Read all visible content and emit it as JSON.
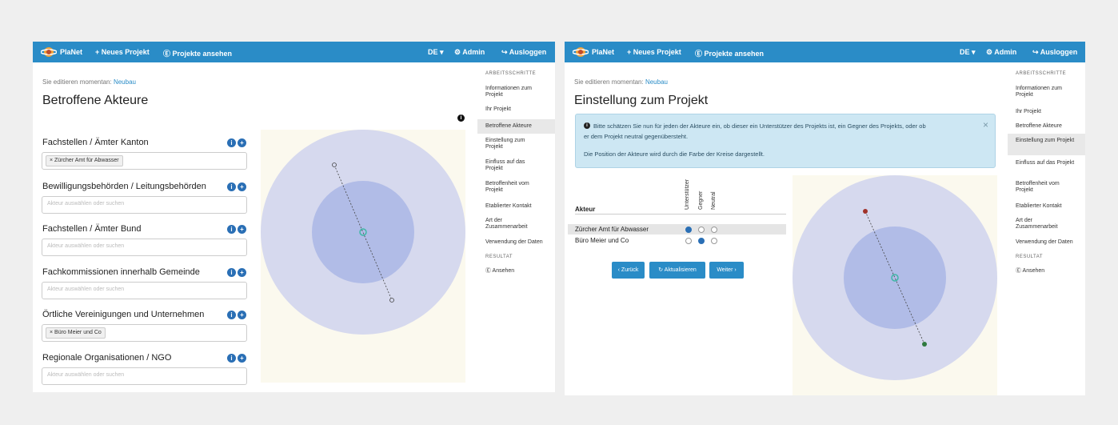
{
  "app": {
    "brand": "PlaNet",
    "nav_new": "+ Neues Projekt",
    "nav_view": "Ⓔ Projekte ansehen",
    "lang": "DE ▾",
    "admin": "⚙ Admin",
    "logout": "↪ Ausloggen"
  },
  "colors": {
    "primary": "#2a8cc7",
    "outer_circle": "#d6d9ee",
    "inner_circle": "#b1bce7",
    "chart_bg": "#fbf9ee",
    "marker_center": "#3fb7a7",
    "marker_red": "#a0322a",
    "marker_green": "#2f7a3e"
  },
  "sidebar": {
    "section_steps": "ARBEITSSCHRITTE",
    "items": [
      "Informationen zum Projekt",
      "Ihr Projekt",
      "Betroffene Akteure",
      "Einstellung zum Projekt",
      "Einfluss auf das Projekt",
      "Betroffenheit vom Projekt",
      "Etablierter Kontakt",
      "Art der Zusammenarbeit",
      "Verwendung der Daten"
    ],
    "section_result": "RESULTAT",
    "view": "Ⓔ Ansehen"
  },
  "left": {
    "editing_prefix": "Sie editieren momentan:",
    "project_name": "Neubau",
    "page_title": "Betroffene Akteure",
    "placeholder": "Akteur auswählen oder suchen",
    "groups": [
      {
        "label": "Fachstellen / Ämter Kanton",
        "tag": "× Zürcher Amt für Abwasser"
      },
      {
        "label": "Bewilligungsbehörden / Leitungsbehörden",
        "tag": ""
      },
      {
        "label": "Fachstellen / Ämter Bund",
        "tag": ""
      },
      {
        "label": "Fachkommissionen innerhalb Gemeinde",
        "tag": ""
      },
      {
        "label": "Örtliche Vereinigungen und Unternehmen",
        "tag": "× Büro Meier und Co"
      },
      {
        "label": "Regionale Organisationen / NGO",
        "tag": ""
      }
    ]
  },
  "right": {
    "editing_prefix": "Sie editieren momentan:",
    "project_name": "Neubau",
    "page_title": "Einstellung zum Projekt",
    "alert_line1": "Bitte schätzen Sie nun für jeden der Akteure ein, ob dieser ein Unterstützer des Projekts ist, ein Gegner des Projekts, oder ob",
    "alert_line2": "er dem Projekt neutral gegenübersteht.",
    "alert_line3": "Die Position der Akteure wird durch die Farbe der Kreise dargestellt.",
    "alert_close": "×",
    "table_header": "Akteur",
    "columns": [
      "Unterstützer",
      "Gegner",
      "Neutral"
    ],
    "rows": [
      {
        "name": "Zürcher Amt für Abwasser",
        "selected": 0
      },
      {
        "name": "Büro Meier und Co",
        "selected": 1
      }
    ],
    "btn_back": "‹ Zurück",
    "btn_refresh": "↻ Aktualisieren",
    "btn_next": "Weiter ›"
  }
}
